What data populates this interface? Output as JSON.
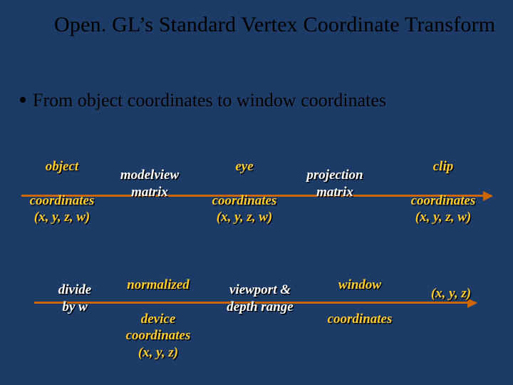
{
  "title": "Open. GL’s Standard\nVertex Coordinate Transform",
  "bullet": "From object coordinates to window coordinates",
  "row1": {
    "stage1": "object\n\ncoordinates\n(x, y, z, w)",
    "box1": "modelview\nmatrix",
    "stage2": "eye\n\ncoordinates\n(x, y, z, w)",
    "box2": "projection\nmatrix",
    "stage3": "clip\n\ncoordinates\n(x, y, z, w)"
  },
  "row2": {
    "box1": "divide\nby w",
    "stage1": "normalized\n\ndevice\ncoordinates\n(x, y, z)",
    "box2": "viewport &\ndepth range",
    "stage2": "window\n\ncoordinates",
    "stage3": "(x, y, z)"
  }
}
